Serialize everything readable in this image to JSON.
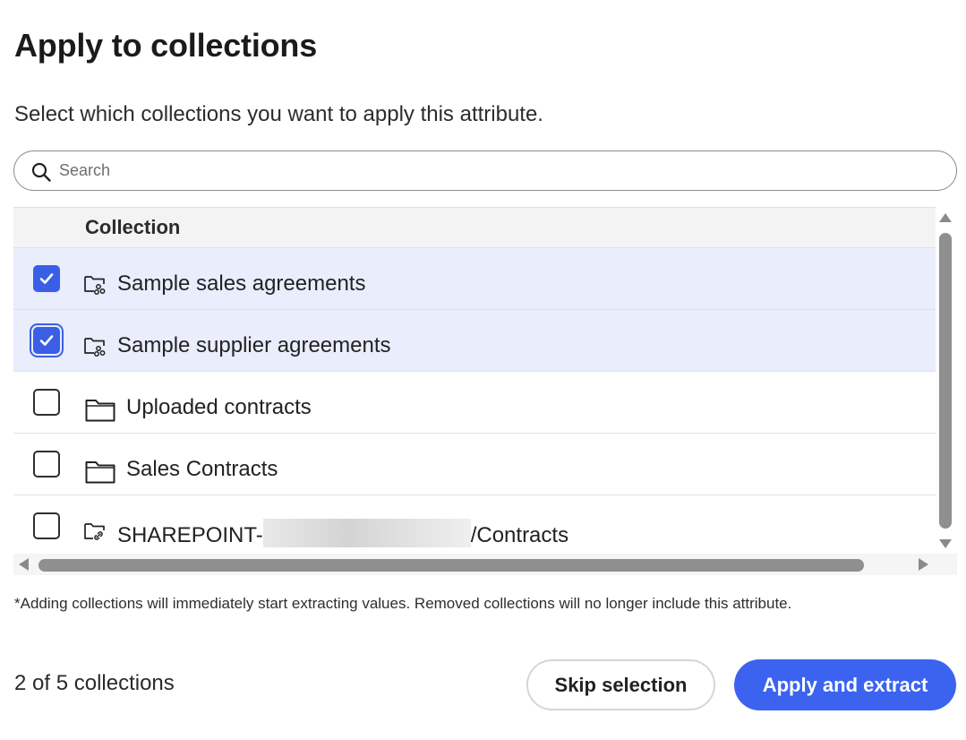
{
  "dialog": {
    "title": "Apply to collections",
    "subtitle": "Select which collections you want to apply this attribute."
  },
  "search": {
    "placeholder": "Search",
    "value": ""
  },
  "table": {
    "column_header": "Collection",
    "rows": [
      {
        "label": "Sample sales agreements",
        "checked": true,
        "icon": "shared-folder-icon"
      },
      {
        "label": "Sample supplier agreements",
        "checked": true,
        "icon": "shared-folder-icon"
      },
      {
        "label": "Uploaded contracts",
        "checked": false,
        "icon": "folder-icon"
      },
      {
        "label": "Sales Contracts",
        "checked": false,
        "icon": "folder-icon"
      },
      {
        "label_prefix": "SHAREPOINT-",
        "label_suffix": "/Contracts",
        "checked": false,
        "icon": "linked-folder-icon"
      }
    ]
  },
  "note": "*Adding collections will immediately start extracting values. Removed collections will no longer include this attribute.",
  "footer": {
    "count_label": "2 of 5 collections",
    "skip_label": "Skip selection",
    "apply_label": "Apply and extract"
  },
  "colors": {
    "accent": "#3b63f0",
    "selected_row": "#e9edfc",
    "header_bg": "#f3f3f3"
  }
}
